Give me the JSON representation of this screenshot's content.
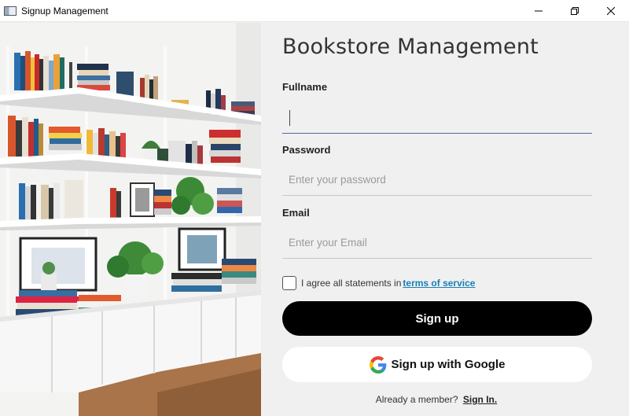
{
  "window": {
    "title": "Signup Management",
    "controls": [
      "minimize-icon",
      "restore-icon",
      "close-icon"
    ]
  },
  "photo": {
    "subject": "bookshelf-photo"
  },
  "form": {
    "heading": "Bookstore Management",
    "fullname": {
      "label": "Fullname",
      "value": "",
      "placeholder": ""
    },
    "password": {
      "label": "Password",
      "value": "",
      "placeholder": "Enter your password"
    },
    "email": {
      "label": "Email",
      "value": "",
      "placeholder": "Enter your Email"
    },
    "terms": {
      "text": "I agree all statements in",
      "link": "terms of service",
      "checked": false
    },
    "signup_button": "Sign up",
    "google_button": "Sign up with Google",
    "footer": {
      "text": "Already a member?",
      "link": "Sign In."
    }
  },
  "colors": {
    "accent_line": "#5566aa",
    "link": "#1a7fb4",
    "primary_button": "#000000"
  }
}
